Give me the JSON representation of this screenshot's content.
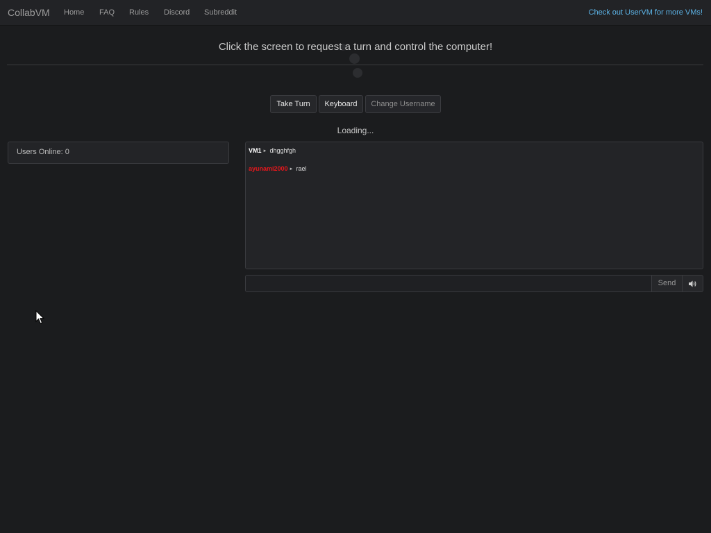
{
  "navbar": {
    "brand": "CollabVM",
    "links": [
      "Home",
      "FAQ",
      "Rules",
      "Discord",
      "Subreddit"
    ],
    "promo": "Check out UserVM for more VMs!"
  },
  "main": {
    "headline": "Click the screen to request a turn and control the computer!",
    "loading": "Loading..."
  },
  "buttons": {
    "take_turn": "Take Turn",
    "keyboard": "Keyboard",
    "change_username": "Change Username"
  },
  "users": {
    "label": "Users Online: 0"
  },
  "chat": {
    "messages": [
      {
        "user": "VM1",
        "text": "dhgghfgh",
        "color": "#ffffff"
      },
      {
        "user": "ayunami2000",
        "text": "rael",
        "color": "#e8171c"
      }
    ],
    "input_value": "",
    "send_label": "Send",
    "sound_icon": "volume-icon"
  },
  "colors": {
    "background": "#1b1c1e",
    "navbar": "#222326",
    "link_accent": "#5cb3e6"
  }
}
